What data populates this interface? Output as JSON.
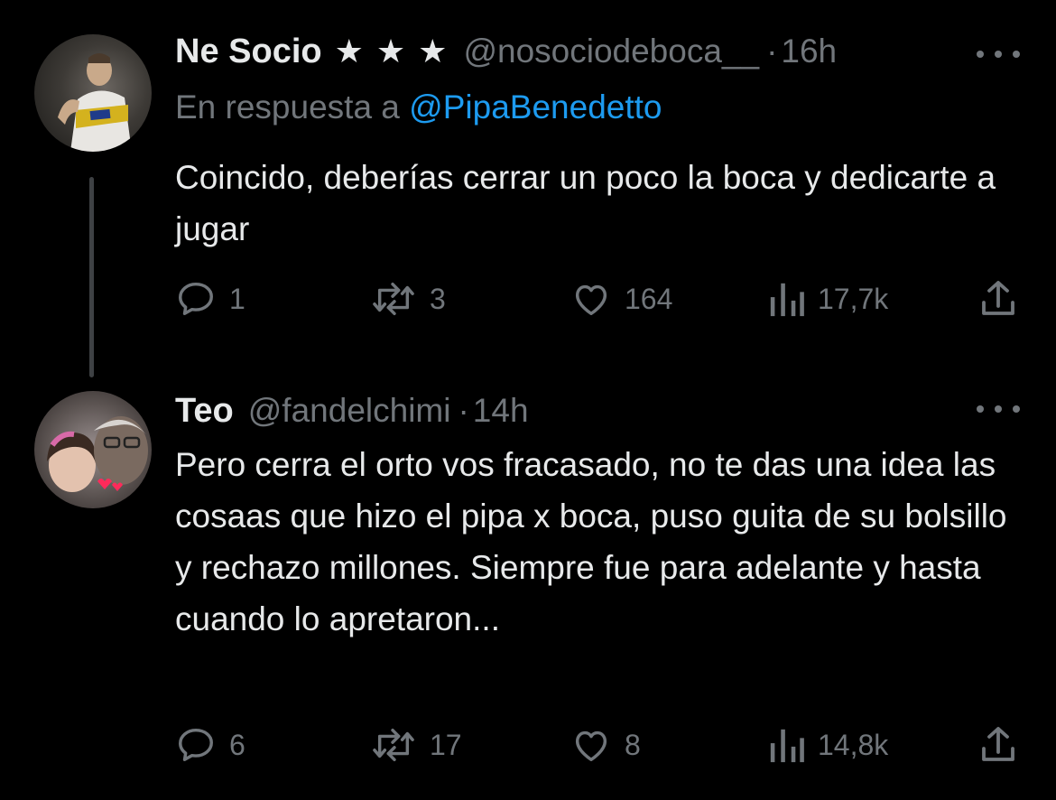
{
  "tweets": [
    {
      "name": "Ne Socio",
      "badge": "★ ★ ★",
      "handle": "@nosociodeboca__",
      "dot": "·",
      "time": "16h",
      "reply_prefix": "En respuesta a",
      "reply_mention": "@PipaBenedetto",
      "text": "Coincido, deberías cerrar un poco la boca y dedicarte a jugar",
      "replies": "1",
      "retweets": "3",
      "likes": "164",
      "views": "17,7k"
    },
    {
      "name": "Teo",
      "handle": "@fandelchimi",
      "dot": "·",
      "time": "14h",
      "text": "Pero cerra el orto vos fracasado, no te das una idea las cosaas que hizo el pipa x boca, puso guita de su bolsillo y rechazo millones. Siempre fue para adelante y hasta cuando lo apretaron...",
      "replies": "6",
      "retweets": "17",
      "likes": "8",
      "views": "14,8k"
    }
  ],
  "colors": {
    "background": "#000000",
    "text": "#e7e9ea",
    "secondary": "#71767b",
    "link": "#1d9bf0",
    "thread_line": "#3e4144"
  },
  "icons": [
    "reply-icon",
    "retweet-icon",
    "like-icon",
    "views-icon",
    "share-icon",
    "more-icon"
  ]
}
